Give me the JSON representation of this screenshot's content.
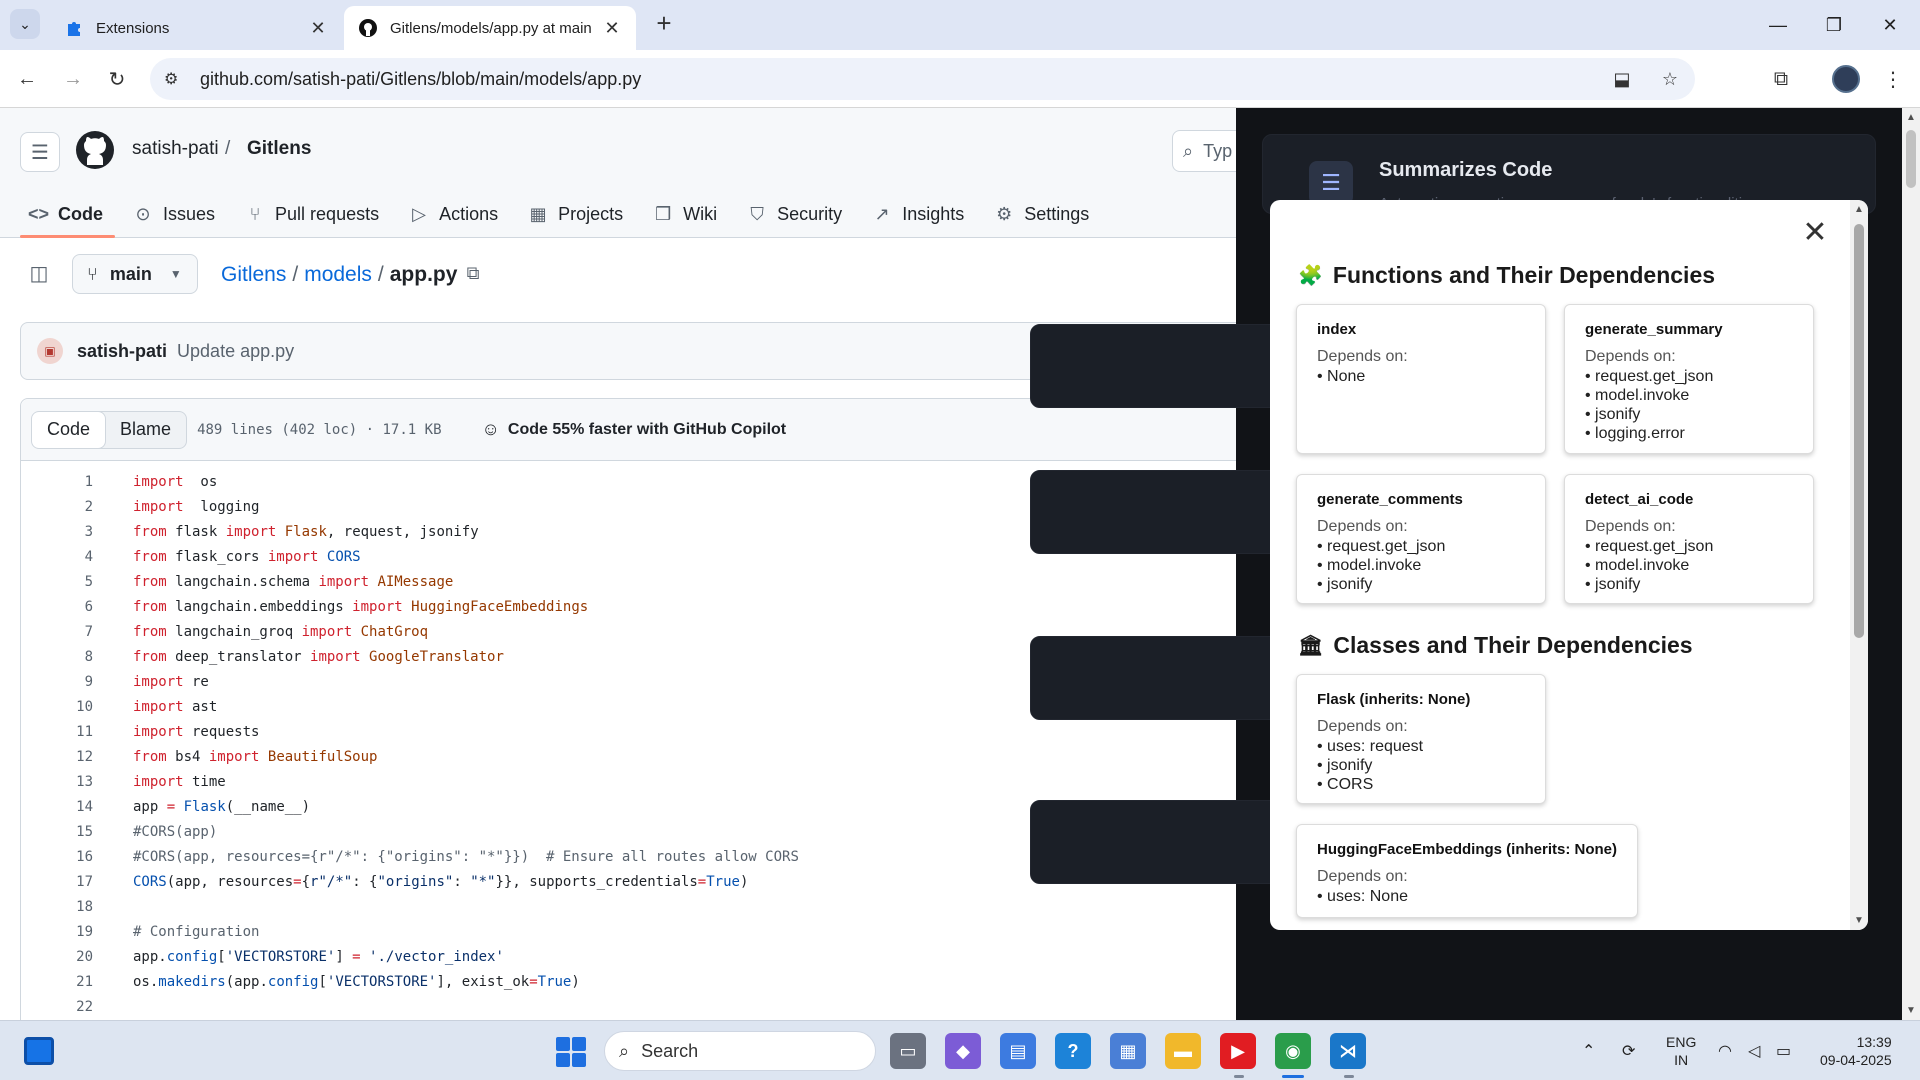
{
  "browser": {
    "tabs": [
      {
        "label": "Extensions",
        "icon": "puzzle-icon",
        "active": false
      },
      {
        "label": "Gitlens/models/app.py at main",
        "icon": "github-icon",
        "active": true
      }
    ],
    "url": "github.com/satish-pati/Gitlens/blob/main/models/app.py"
  },
  "repo": {
    "owner": "satish-pati",
    "separator": "/",
    "name": "Gitlens",
    "search_placeholder": "Typ",
    "nav": [
      {
        "label": "Code",
        "icon": "code-icon",
        "selected": true
      },
      {
        "label": "Issues",
        "icon": "issue-icon",
        "selected": false
      },
      {
        "label": "Pull requests",
        "icon": "pull-request-icon",
        "selected": false
      },
      {
        "label": "Actions",
        "icon": "play-icon",
        "selected": false
      },
      {
        "label": "Projects",
        "icon": "table-icon",
        "selected": false
      },
      {
        "label": "Wiki",
        "icon": "book-icon",
        "selected": false
      },
      {
        "label": "Security",
        "icon": "shield-icon",
        "selected": false
      },
      {
        "label": "Insights",
        "icon": "graph-icon",
        "selected": false
      },
      {
        "label": "Settings",
        "icon": "gear-icon",
        "selected": false
      }
    ]
  },
  "file": {
    "branch": "main",
    "path": [
      {
        "label": "Gitlens"
      },
      {
        "label": "models"
      }
    ],
    "filename": "app.py",
    "commit_author": "satish-pati",
    "commit_message": "Update app.py",
    "view_code": "Code",
    "view_blame": "Blame",
    "info": "489 lines (402 loc) · 17.1 KB",
    "copilot": "Code 55% faster with GitHub Copilot"
  },
  "code_lines": [
    {
      "n": "1",
      "t": [
        [
          "kw",
          "import"
        ],
        [
          "",
          "  os"
        ]
      ]
    },
    {
      "n": "2",
      "t": [
        [
          "kw",
          "import"
        ],
        [
          "",
          "  logging"
        ]
      ]
    },
    {
      "n": "3",
      "t": [
        [
          "kw",
          "from"
        ],
        [
          "",
          " flask "
        ],
        [
          "kw",
          "import"
        ],
        [
          "",
          " "
        ],
        [
          "cls",
          "Flask"
        ],
        [
          "",
          ", request, jsonify"
        ]
      ]
    },
    {
      "n": "4",
      "t": [
        [
          "kw",
          "from"
        ],
        [
          "",
          " flask_cors "
        ],
        [
          "kw",
          "import"
        ],
        [
          "",
          " "
        ],
        [
          "ent",
          "CORS"
        ]
      ]
    },
    {
      "n": "5",
      "t": [
        [
          "kw",
          "from"
        ],
        [
          "",
          " langchain.schema "
        ],
        [
          "kw",
          "import"
        ],
        [
          "",
          " "
        ],
        [
          "cls",
          "AIMessage"
        ]
      ]
    },
    {
      "n": "6",
      "t": [
        [
          "kw",
          "from"
        ],
        [
          "",
          " langchain.embeddings "
        ],
        [
          "kw",
          "import"
        ],
        [
          "",
          " "
        ],
        [
          "cls",
          "HuggingFaceEmbeddings"
        ]
      ]
    },
    {
      "n": "7",
      "t": [
        [
          "kw",
          "from"
        ],
        [
          "",
          " langchain_groq "
        ],
        [
          "kw",
          "import"
        ],
        [
          "",
          " "
        ],
        [
          "cls",
          "ChatGroq"
        ]
      ]
    },
    {
      "n": "8",
      "t": [
        [
          "kw",
          "from"
        ],
        [
          "",
          " deep_translator "
        ],
        [
          "kw",
          "import"
        ],
        [
          "",
          " "
        ],
        [
          "cls",
          "GoogleTranslator"
        ]
      ]
    },
    {
      "n": "9",
      "t": [
        [
          "kw",
          "import"
        ],
        [
          "",
          " re"
        ]
      ]
    },
    {
      "n": "10",
      "t": [
        [
          "kw",
          "import"
        ],
        [
          "",
          " ast"
        ]
      ]
    },
    {
      "n": "11",
      "t": [
        [
          "kw",
          "import"
        ],
        [
          "",
          " requests"
        ]
      ]
    },
    {
      "n": "12",
      "t": [
        [
          "kw",
          "from"
        ],
        [
          "",
          " bs4 "
        ],
        [
          "kw",
          "import"
        ],
        [
          "",
          " "
        ],
        [
          "cls",
          "BeautifulSoup"
        ]
      ]
    },
    {
      "n": "13",
      "t": [
        [
          "kw",
          "import"
        ],
        [
          "",
          " time"
        ]
      ]
    },
    {
      "n": "14",
      "t": [
        [
          "",
          "app "
        ],
        [
          "kw",
          "="
        ],
        [
          "",
          " "
        ],
        [
          "ent",
          "Flask"
        ],
        [
          "",
          "(__name__)"
        ]
      ]
    },
    {
      "n": "15",
      "t": [
        [
          "cm",
          "#CORS(app)"
        ]
      ]
    },
    {
      "n": "16",
      "t": [
        [
          "cm",
          "#CORS(app, resources={r\"/*\": {\"origins\": \"*\"}})  # Ensure all routes allow CORS"
        ]
      ]
    },
    {
      "n": "17",
      "t": [
        [
          "ent",
          "CORS"
        ],
        [
          "",
          "(app, resources"
        ],
        [
          "kw",
          "="
        ],
        [
          "",
          "{"
        ],
        [
          "str",
          "r\"/*\""
        ],
        [
          "",
          ": {"
        ],
        [
          "str",
          "\"origins\""
        ],
        [
          "",
          ": "
        ],
        [
          "str",
          "\"*\""
        ],
        [
          "",
          "}}, supports_credentials"
        ],
        [
          "kw",
          "="
        ],
        [
          "ent",
          "True"
        ],
        [
          "",
          ")"
        ]
      ]
    },
    {
      "n": "18",
      "t": []
    },
    {
      "n": "19",
      "t": [
        [
          "cm",
          "# Configuration"
        ]
      ]
    },
    {
      "n": "20",
      "t": [
        [
          "",
          "app."
        ],
        [
          "ent",
          "config"
        ],
        [
          "",
          "["
        ],
        [
          "str",
          "'VECTORSTORE'"
        ],
        [
          "",
          "] "
        ],
        [
          "kw",
          "="
        ],
        [
          "",
          " "
        ],
        [
          "str",
          "'./vector_index'"
        ]
      ]
    },
    {
      "n": "21",
      "t": [
        [
          "",
          "os."
        ],
        [
          "ent",
          "makedirs"
        ],
        [
          "",
          "(app."
        ],
        [
          "ent",
          "config"
        ],
        [
          "",
          "["
        ],
        [
          "str",
          "'VECTORSTORE'"
        ],
        [
          "",
          "], exist_ok"
        ],
        [
          "kw",
          "="
        ],
        [
          "ent",
          "True"
        ],
        [
          "",
          ")"
        ]
      ]
    },
    {
      "n": "22",
      "t": []
    }
  ],
  "extension": {
    "card_title": "Summarizes Code",
    "card_subtitle": "Automatic generating a summary of code's functionalities"
  },
  "modal": {
    "functions_title": "Functions and Their Dependencies",
    "classes_title": "Classes and Their Dependencies",
    "depends_label": "Depends on:",
    "functions": [
      {
        "name": "index",
        "deps": [
          "• None"
        ]
      },
      {
        "name": "generate_summary",
        "deps": [
          "• request.get_json",
          "• model.invoke",
          "• jsonify",
          "• logging.error"
        ]
      },
      {
        "name": "generate_comments",
        "deps": [
          "• request.get_json",
          "• model.invoke",
          "• jsonify"
        ]
      },
      {
        "name": "detect_ai_code",
        "deps": [
          "• request.get_json",
          "• model.invoke",
          "• jsonify"
        ]
      }
    ],
    "classes": [
      {
        "name": "Flask (inherits: None)",
        "deps": [
          "• uses: request",
          "• jsonify",
          "• CORS"
        ]
      },
      {
        "name": "HuggingFaceEmbeddings (inherits: None)",
        "deps": [
          "• uses: None"
        ]
      }
    ]
  },
  "taskbar": {
    "search_label": "Search",
    "lang_line1": "ENG",
    "lang_line2": "IN",
    "time": "13:39",
    "date": "09-04-2025"
  }
}
